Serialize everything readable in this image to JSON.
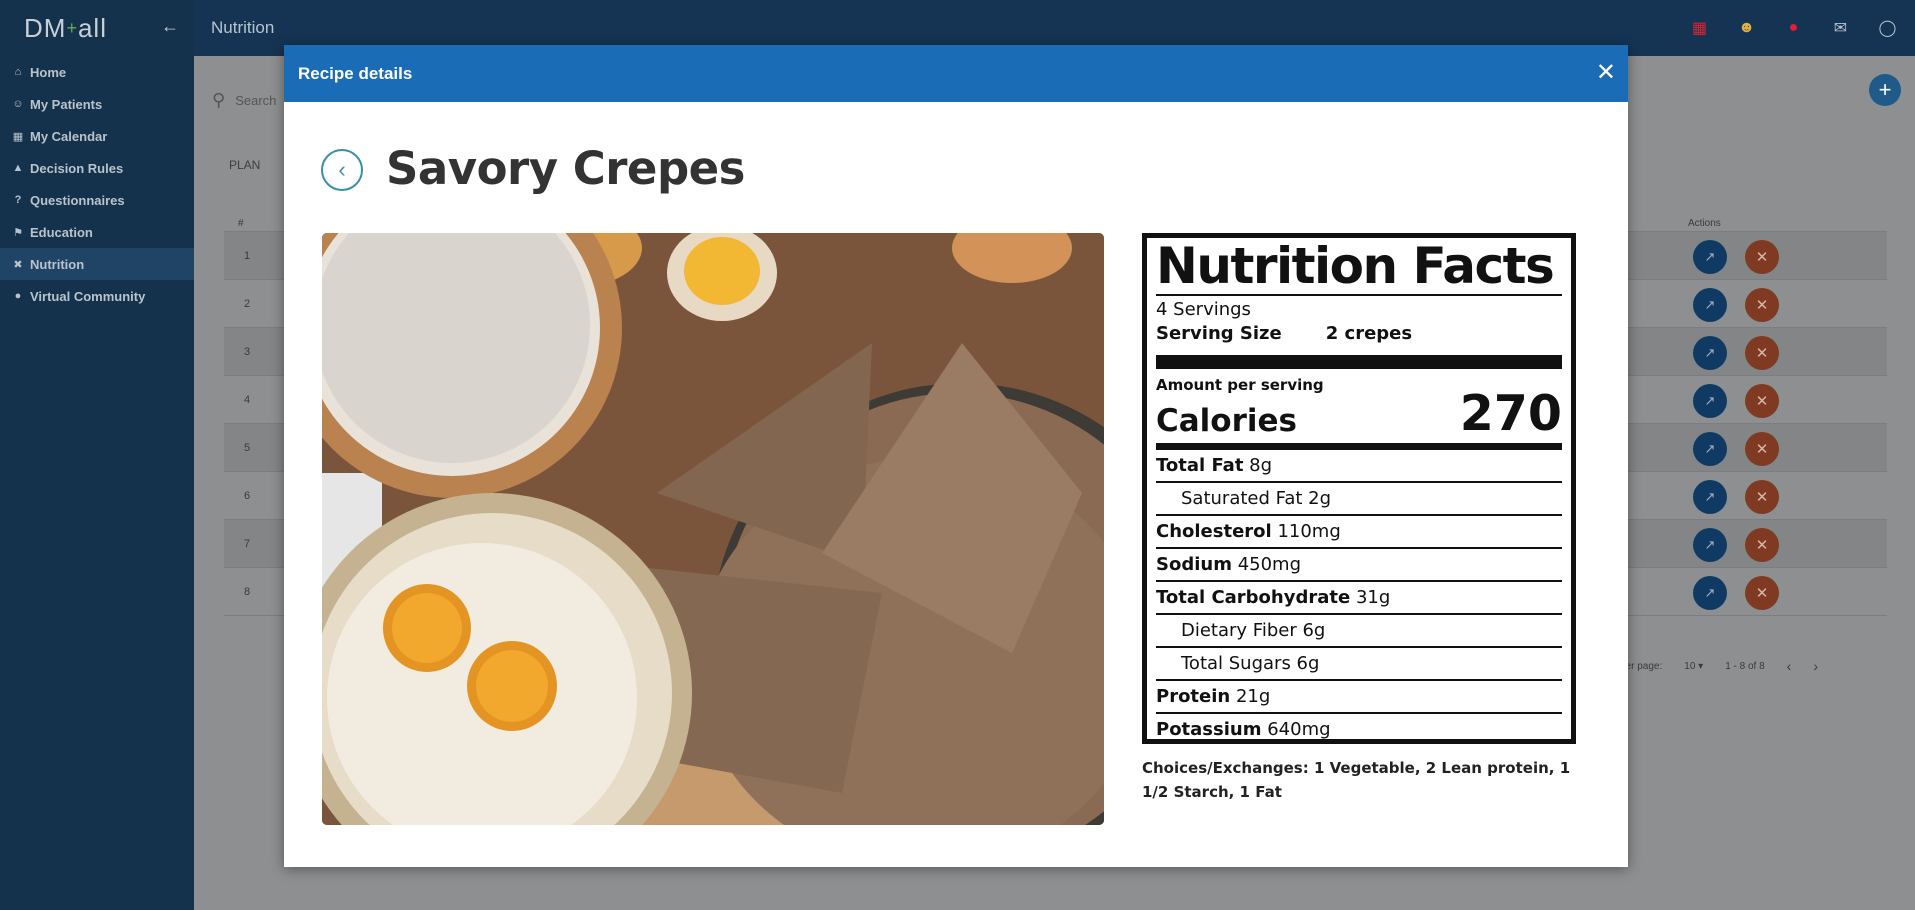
{
  "app": {
    "logo_text": "DM",
    "logo_plus": "+",
    "logo_tail": "all",
    "page_title": "Nutrition"
  },
  "sidebar": {
    "items": [
      {
        "label": "Home",
        "icon": "home-icon"
      },
      {
        "label": "My Patients",
        "icon": "person-icon"
      },
      {
        "label": "My Calendar",
        "icon": "calendar-icon"
      },
      {
        "label": "Decision Rules",
        "icon": "warning-icon"
      },
      {
        "label": "Questionnaires",
        "icon": "question-icon"
      },
      {
        "label": "Education",
        "icon": "graduation-cap-icon"
      },
      {
        "label": "Nutrition",
        "icon": "utensils-icon",
        "active": true
      },
      {
        "label": "Virtual Community",
        "icon": "globe-icon"
      }
    ]
  },
  "background": {
    "search_placeholder": "Search",
    "tab_plan": "PLAN",
    "table_hash": "#",
    "table_actions": "Actions",
    "rows": [
      "1",
      "2",
      "3",
      "4",
      "5",
      "6",
      "7",
      "8"
    ],
    "pager": {
      "rows_per_page_label": "ner page:",
      "rows_per_page": "10",
      "range": "1 - 8 of 8"
    }
  },
  "modal": {
    "header_title": "Recipe details",
    "recipe_title": "Savory Crepes",
    "nutrition": {
      "heading": "Nutrition Facts",
      "servings": "4 Servings",
      "serving_size_label": "Serving Size",
      "serving_size_value": "2 crepes",
      "amount_per_serving": "Amount per serving",
      "calories_label": "Calories",
      "calories_value": "270",
      "rows": [
        {
          "label": "Total Fat",
          "value": "8g",
          "indent": false
        },
        {
          "label": "",
          "value": "Saturated Fat 2g",
          "indent": true
        },
        {
          "label": "Cholesterol",
          "value": "110mg",
          "indent": false
        },
        {
          "label": "Sodium",
          "value": "450mg",
          "indent": false
        },
        {
          "label": "Total Carbohydrate",
          "value": "31g",
          "indent": false
        },
        {
          "label": "",
          "value": "Dietary Fiber 6g",
          "indent": true
        },
        {
          "label": "",
          "value": "Total Sugars 6g",
          "indent": true
        },
        {
          "label": "Protein",
          "value": "21g",
          "indent": false
        },
        {
          "label": "Potassium",
          "value": "640mg",
          "indent": false
        }
      ]
    },
    "choices": "Choices/Exchanges: 1 Vegetable, 2 Lean protein, 1 1/2 Starch, 1 Fat"
  },
  "colors": {
    "sidebar": "#14324c",
    "topbar": "#153453",
    "modal_header": "#1b6cb7",
    "edit_button": "#0e3a63",
    "delete_button": "#813a22"
  }
}
